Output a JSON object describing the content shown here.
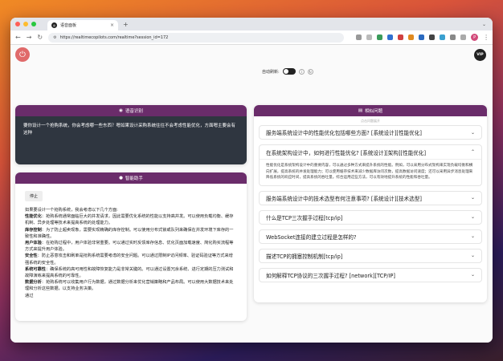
{
  "browser": {
    "tab_title": "语音面板",
    "tab_icon": "realtime-logo",
    "url": "https://realtimecopilots.com/realtime?session_id=172",
    "colors": {
      "close": "#ff5f57",
      "min": "#febc2e",
      "max": "#28c840"
    }
  },
  "topbar": {
    "vip_label": "VIP",
    "autoscroll_label": "自动刷新:",
    "accent": "#6a2c6a"
  },
  "speech": {
    "header": "语音识别",
    "text": "要你设计一个抢购系统，你会考虑哪一些东西？嗯如果设计采购系统往往不会考虑性能优化，方面嗯主要会有这种"
  },
  "assistant": {
    "header": "智能助手",
    "stop_label": "停止",
    "intro": "如果要设计一个抢购系统，我会考虑以下几个方面:",
    "points": [
      {
        "title": "性能优化",
        "text": "：抢购系统通常面临巨大的并发请求，因此需要优化系统的性能以支持高并发。可以使用负载均衡、缓存机制、异步处理等技术来提高系统的处理能力。"
      },
      {
        "title": "库存控制",
        "text": "：为了防止超卖现象，需要实现精确的库存控制。可以使用分布式锁或队列来确保在并发环境下库存的一致性和准确性。"
      },
      {
        "title": "用户体验",
        "text": "：在抢购过程中，用户体验非常重要。可以通过实时反馈库存信息、优化页面加载速度、简化购买流程等方式来提升用户体验。"
      },
      {
        "title": "安全性",
        "text": "：防止恶意攻击和刷单是抢购系统需要考虑的安全问题。可以通过限制IP访问频率、验证码验证等方式来增强系统的安全性。"
      },
      {
        "title": "系统可靠性",
        "text": "：确保系统的高可用性和故障恢复能力是非常关键的。可以通过设置冗余系统、进行定期的压力测试和故障演练来提高系统的可靠性。"
      },
      {
        "title": "数据分析",
        "text": "：抢购系统可以收集用户行为数据，通过数据分析来优化营销策略和产品布局。可以使用大数据技术来处理和分析这些数据，以支持业务决策。"
      }
    ],
    "outro": "通过"
  },
  "related": {
    "header": "相似问题",
    "subtitle": "点击问题展开",
    "questions": [
      {
        "title": "服务端系统设计中的性能优化包括哪些方面? [系统设计][性能优化]"
      },
      {
        "title": "在系统架构设计中，如何进行性能优化? [系统设计][架构][性能优化]",
        "answer": "性能优化是系统架构设计中的重要内容，可以通过多种方式来提升系统的性能。例如，可以采用分布式架构来实现负载均衡和横向扩展，提高系统的并发处理能力；可以使用缓存技术来减少数据库访问次数，提高数据访问速度；还可以采用异步消息处理来降低系统的响应时间，提高系统的吞吐量。综合运用这些方法，可以有效地提升系统的性能和吞吐量。"
      },
      {
        "title": "服务端系统设计中的技术选型有何注意事项? [系统设计][技术选型]"
      },
      {
        "title": "什么是TCP三次握手过程[tcp/ip]"
      },
      {
        "title": "WebSocket连接的建立过程是怎样的?"
      },
      {
        "title": "描述TCP的拥塞控制机制[tcp/ip]"
      },
      {
        "title": "如何解释TCP协议的三次握手过程? [network][TCP/IP]"
      }
    ]
  }
}
